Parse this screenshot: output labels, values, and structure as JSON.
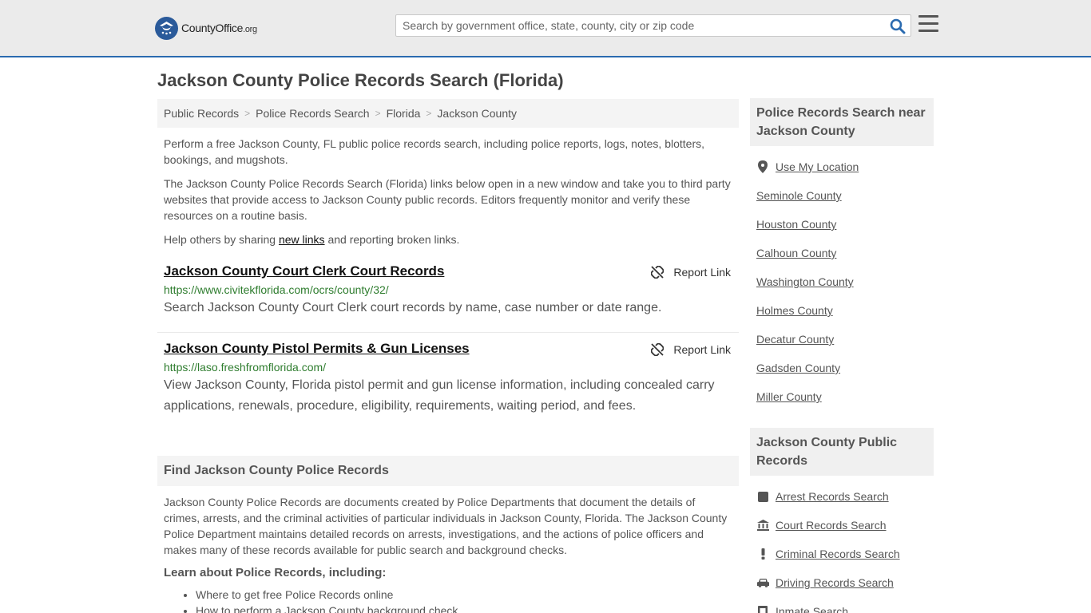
{
  "header": {
    "logo_main": "CountyOffice",
    "logo_tld": ".org",
    "search_placeholder": "Search by government office, state, county, city or zip code"
  },
  "page_title": "Jackson County Police Records Search (Florida)",
  "breadcrumb": [
    "Public Records",
    "Police Records Search",
    "Florida",
    "Jackson County"
  ],
  "intro": {
    "p1": "Perform a free Jackson County, FL public police records search, including police reports, logs, notes, blotters, bookings, and mugshots.",
    "p2": "The Jackson County Police Records Search (Florida) links below open in a new window and take you to third party websites that provide access to Jackson County public records. Editors frequently monitor and verify these resources on a routine basis.",
    "p3_before": "Help others by sharing ",
    "p3_link": "new links",
    "p3_after": " and reporting broken links."
  },
  "records": [
    {
      "title": "Jackson County Court Clerk Court Records",
      "url": "https://www.civitekflorida.com/ocrs/county/32/",
      "description": "Search Jackson County Court Clerk court records by name, case number or date range.",
      "report_label": "Report Link"
    },
    {
      "title": "Jackson County Pistol Permits & Gun Licenses",
      "url": "https://laso.freshfromflorida.com/",
      "description": "View Jackson County, Florida pistol permit and gun license information, including concealed carry applications, renewals, procedure, eligibility, requirements, waiting period, and fees.",
      "report_label": "Report Link"
    }
  ],
  "find_section": {
    "heading": "Find Jackson County Police Records",
    "body": "Jackson County Police Records are documents created by Police Departments that document the details of crimes, arrests, and the criminal activities of particular individuals in Jackson County, Florida. The Jackson County Police Department maintains detailed records on arrests, investigations, and the actions of police officers and makes many of these records available for public search and background checks.",
    "learn_heading": "Learn about Police Records, including:",
    "bullets": [
      "Where to get free Police Records online",
      "How to perform a Jackson County background check"
    ]
  },
  "sidebar_near": {
    "heading": "Police Records Search near Jackson County",
    "use_location": "Use My Location",
    "counties": [
      "Seminole County",
      "Houston County",
      "Calhoun County",
      "Washington County",
      "Holmes County",
      "Decatur County",
      "Gadsden County",
      "Miller County"
    ]
  },
  "sidebar_public": {
    "heading": "Jackson County Public Records",
    "items": [
      {
        "label": "Arrest Records Search",
        "icon": "square-icon"
      },
      {
        "label": "Court Records Search",
        "icon": "courthouse-icon"
      },
      {
        "label": "Criminal Records Search",
        "icon": "exclamation-icon"
      },
      {
        "label": "Driving Records Search",
        "icon": "car-icon"
      },
      {
        "label": "Inmate Search",
        "icon": "inmate-icon"
      }
    ]
  },
  "colors": {
    "accent": "#2b6bb0",
    "url_green": "#2f7d2f",
    "header_bg": "#ebebeb"
  }
}
